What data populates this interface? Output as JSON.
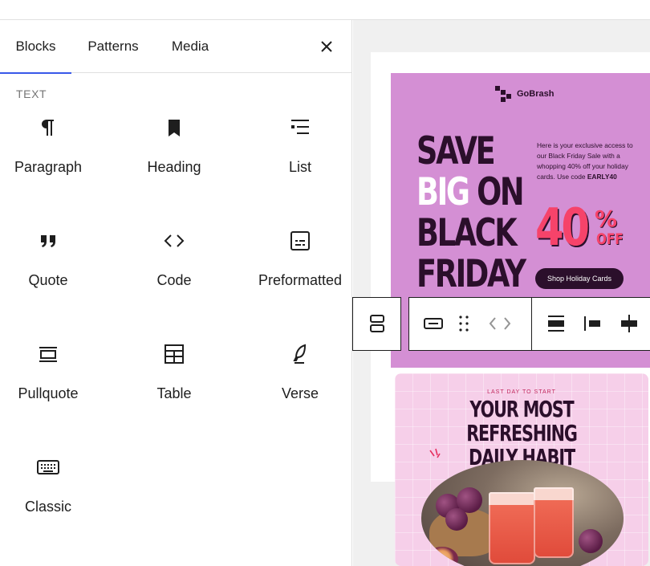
{
  "inserter": {
    "tabs": [
      {
        "label": "Blocks",
        "active": true
      },
      {
        "label": "Patterns",
        "active": false
      },
      {
        "label": "Media",
        "active": false
      }
    ],
    "close_icon": "close-icon",
    "section_title": "TEXT",
    "blocks": [
      {
        "label": "Paragraph",
        "icon": "paragraph-icon"
      },
      {
        "label": "Heading",
        "icon": "heading-bookmark-icon"
      },
      {
        "label": "List",
        "icon": "list-icon"
      },
      {
        "label": "Quote",
        "icon": "quote-icon"
      },
      {
        "label": "Code",
        "icon": "code-icon"
      },
      {
        "label": "Preformatted",
        "icon": "preformatted-icon"
      },
      {
        "label": "Pullquote",
        "icon": "pullquote-icon"
      },
      {
        "label": "Table",
        "icon": "table-icon"
      },
      {
        "label": "Verse",
        "icon": "verse-icon"
      },
      {
        "label": "Classic",
        "icon": "keyboard-icon"
      }
    ]
  },
  "toolbar": {
    "parent_icon": "select-parent-stack-icon",
    "buttons": [
      "row-block-icon",
      "drag-handle-icon",
      "move-arrows-icon",
      "align-center-icon",
      "justify-left-icon",
      "justify-center-icon"
    ]
  },
  "canvas": {
    "black_friday": {
      "brand": "GoBrash",
      "headline_line1": "SAVE",
      "headline_line2a": "BIG",
      "headline_line2b": "ON",
      "headline_line3": "BLACK",
      "headline_line4": "FRIDAY",
      "copy": "Here is your exclusive access to our Black Friday Sale with a whopping 40% off your holiday cards. Use code",
      "code": "EARLY40",
      "percent": "40",
      "percent_sign": "%",
      "off": "OFF",
      "button": "Shop Holiday Cards",
      "bg_color": "#d48fd4",
      "accent_color": "#f6436a"
    },
    "habit": {
      "kicker": "LAST DAY TO START",
      "title_line1": "YOUR MOST REFRESHING",
      "title_line2": "DAILY HABIT",
      "bg_color": "#f6cfe9"
    }
  }
}
